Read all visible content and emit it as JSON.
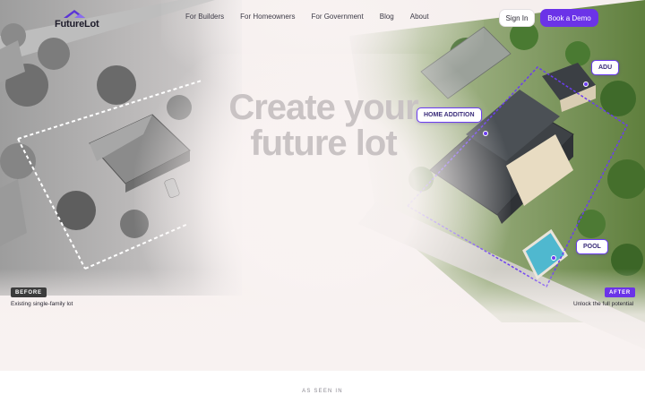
{
  "nav": {
    "logo_text": "FutureLot",
    "links": [
      "For Builders",
      "For Homeowners",
      "For Government",
      "Blog",
      "About"
    ],
    "sign_in": "Sign In",
    "book_demo": "Book a Demo"
  },
  "hero": {
    "headline_line1": "Create your",
    "headline_line2": "future lot",
    "tags": {
      "adu": "ADU",
      "home_addition": "HOME ADDITION",
      "pool": "POOL"
    },
    "before_badge": "BEFORE",
    "before_caption": "Existing single-family lot",
    "after_badge": "AFTER",
    "after_caption": "Unlock the full potential"
  },
  "press": {
    "label": "AS SEEN IN"
  },
  "colors": {
    "accent": "#6b33e8",
    "headline": "#c9c3c4"
  }
}
